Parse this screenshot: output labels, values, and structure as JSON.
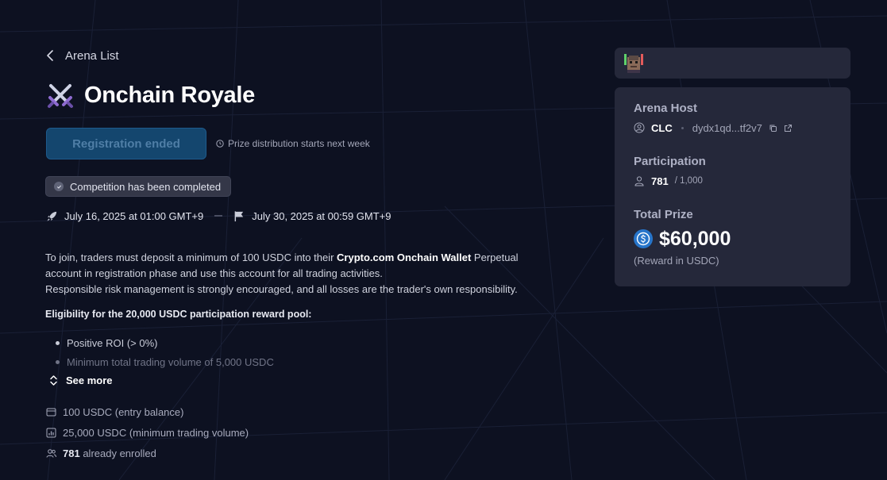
{
  "nav": {
    "back_label": "Arena List"
  },
  "arena": {
    "title": "Onchain Royale",
    "title_icon": "crossed-swords-icon"
  },
  "registration": {
    "button_label": "Registration ended",
    "note": "Prize distribution starts next week"
  },
  "status": {
    "label": "Competition has been completed"
  },
  "dates": {
    "start": "July 16, 2025 at 01:00 GMT+9",
    "end": "July 30, 2025 at 00:59 GMT+9"
  },
  "description": {
    "p1_before": "To join, traders must deposit a minimum of 100 USDC into their ",
    "p1_bold": "Crypto.com Onchain Wallet",
    "p1_after": " Perpetual account in registration phase and use this account for all trading activities.",
    "p2": "Responsible risk management is strongly encouraged, and all losses are the trader's own responsibility."
  },
  "eligibility": {
    "title": "Eligibility for the 20,000 USDC participation reward pool:",
    "items": [
      "Positive ROI (> 0%)",
      "Minimum total trading volume of 5,000 USDC"
    ]
  },
  "see_more_label": "See more",
  "stats": {
    "entry": "100 USDC (entry balance)",
    "volume": "25,000 USDC (minimum trading volume)",
    "enrolled_count": "781",
    "enrolled_suffix": "already enrolled"
  },
  "host": {
    "heading": "Arena Host",
    "name": "CLC",
    "address": "dydx1qd...tf2v7"
  },
  "participation": {
    "heading": "Participation",
    "count": "781",
    "limit": "/ 1,000"
  },
  "prize": {
    "heading": "Total Prize",
    "amount": "$60,000",
    "note": "(Reward in USDC)"
  },
  "colors": {
    "background": "#0d1121",
    "card": "#25283a",
    "button_disabled": "#14466e",
    "usdc_blue": "#2775ca"
  }
}
